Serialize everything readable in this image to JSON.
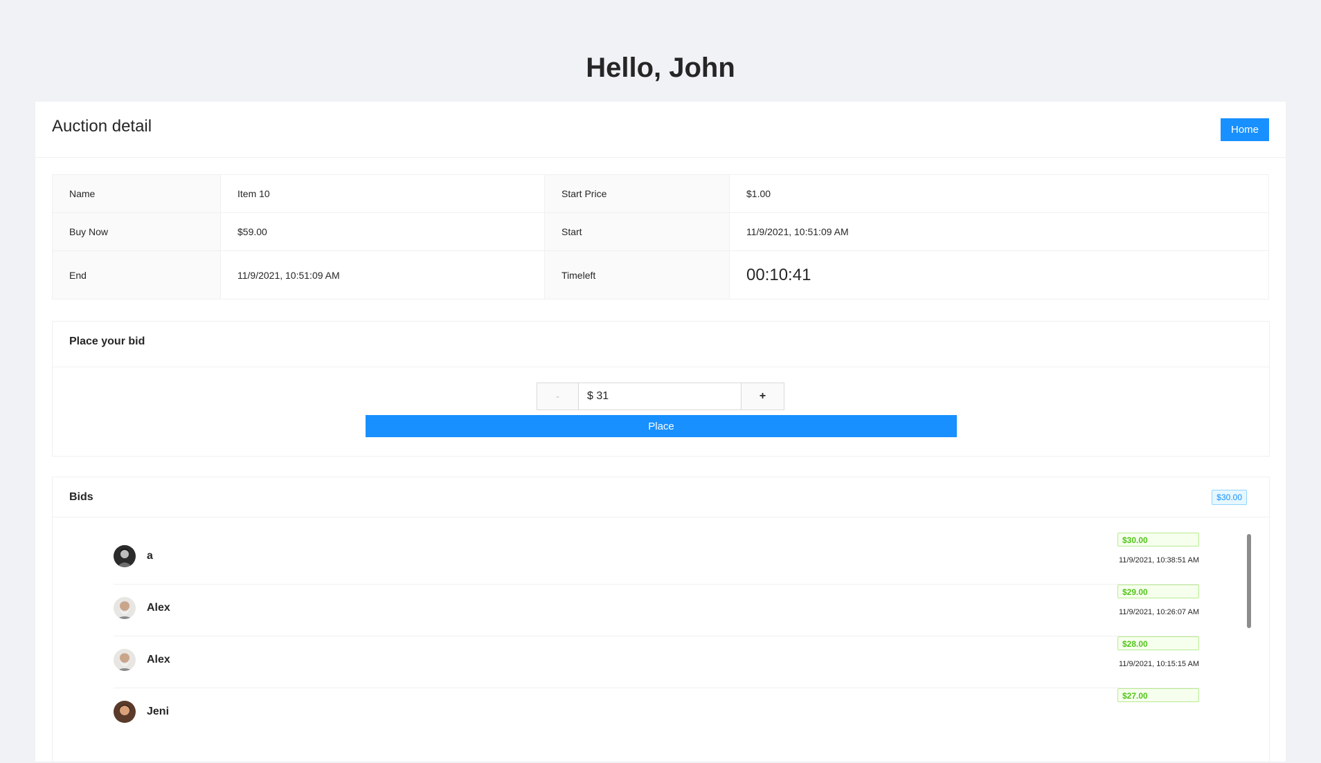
{
  "greeting": "Hello, John",
  "page": {
    "title": "Auction detail",
    "home_label": "Home"
  },
  "details": {
    "name_label": "Name",
    "name_value": "Item 10",
    "start_price_label": "Start Price",
    "start_price_value": "$1.00",
    "buy_now_label": "Buy Now",
    "buy_now_value": "$59.00",
    "start_label": "Start",
    "start_value": "11/9/2021, 10:51:09 AM",
    "end_label": "End",
    "end_value": "11/9/2021, 10:51:09 AM",
    "timeleft_label": "Timeleft",
    "timeleft_value": "00:10:41"
  },
  "bid_form": {
    "title": "Place your bid",
    "minus_label": "-",
    "plus_label": "+",
    "amount_value": "$ 31",
    "place_label": "Place"
  },
  "bids": {
    "title": "Bids",
    "total_tag": "$30.00",
    "items": [
      {
        "name": "a",
        "amount": "$30.00",
        "time": "11/9/2021, 10:38:51 AM",
        "avatar": "person-dark"
      },
      {
        "name": "Alex",
        "amount": "$29.00",
        "time": "11/9/2021, 10:26:07 AM",
        "avatar": "old-man"
      },
      {
        "name": "Alex",
        "amount": "$28.00",
        "time": "11/9/2021, 10:15:15 AM",
        "avatar": "old-man"
      },
      {
        "name": "Jeni",
        "amount": "$27.00",
        "time": "",
        "avatar": "person-brown"
      }
    ]
  },
  "colors": {
    "primary": "#1890ff",
    "success": "#52c41a",
    "background": "#f0f2f5"
  }
}
